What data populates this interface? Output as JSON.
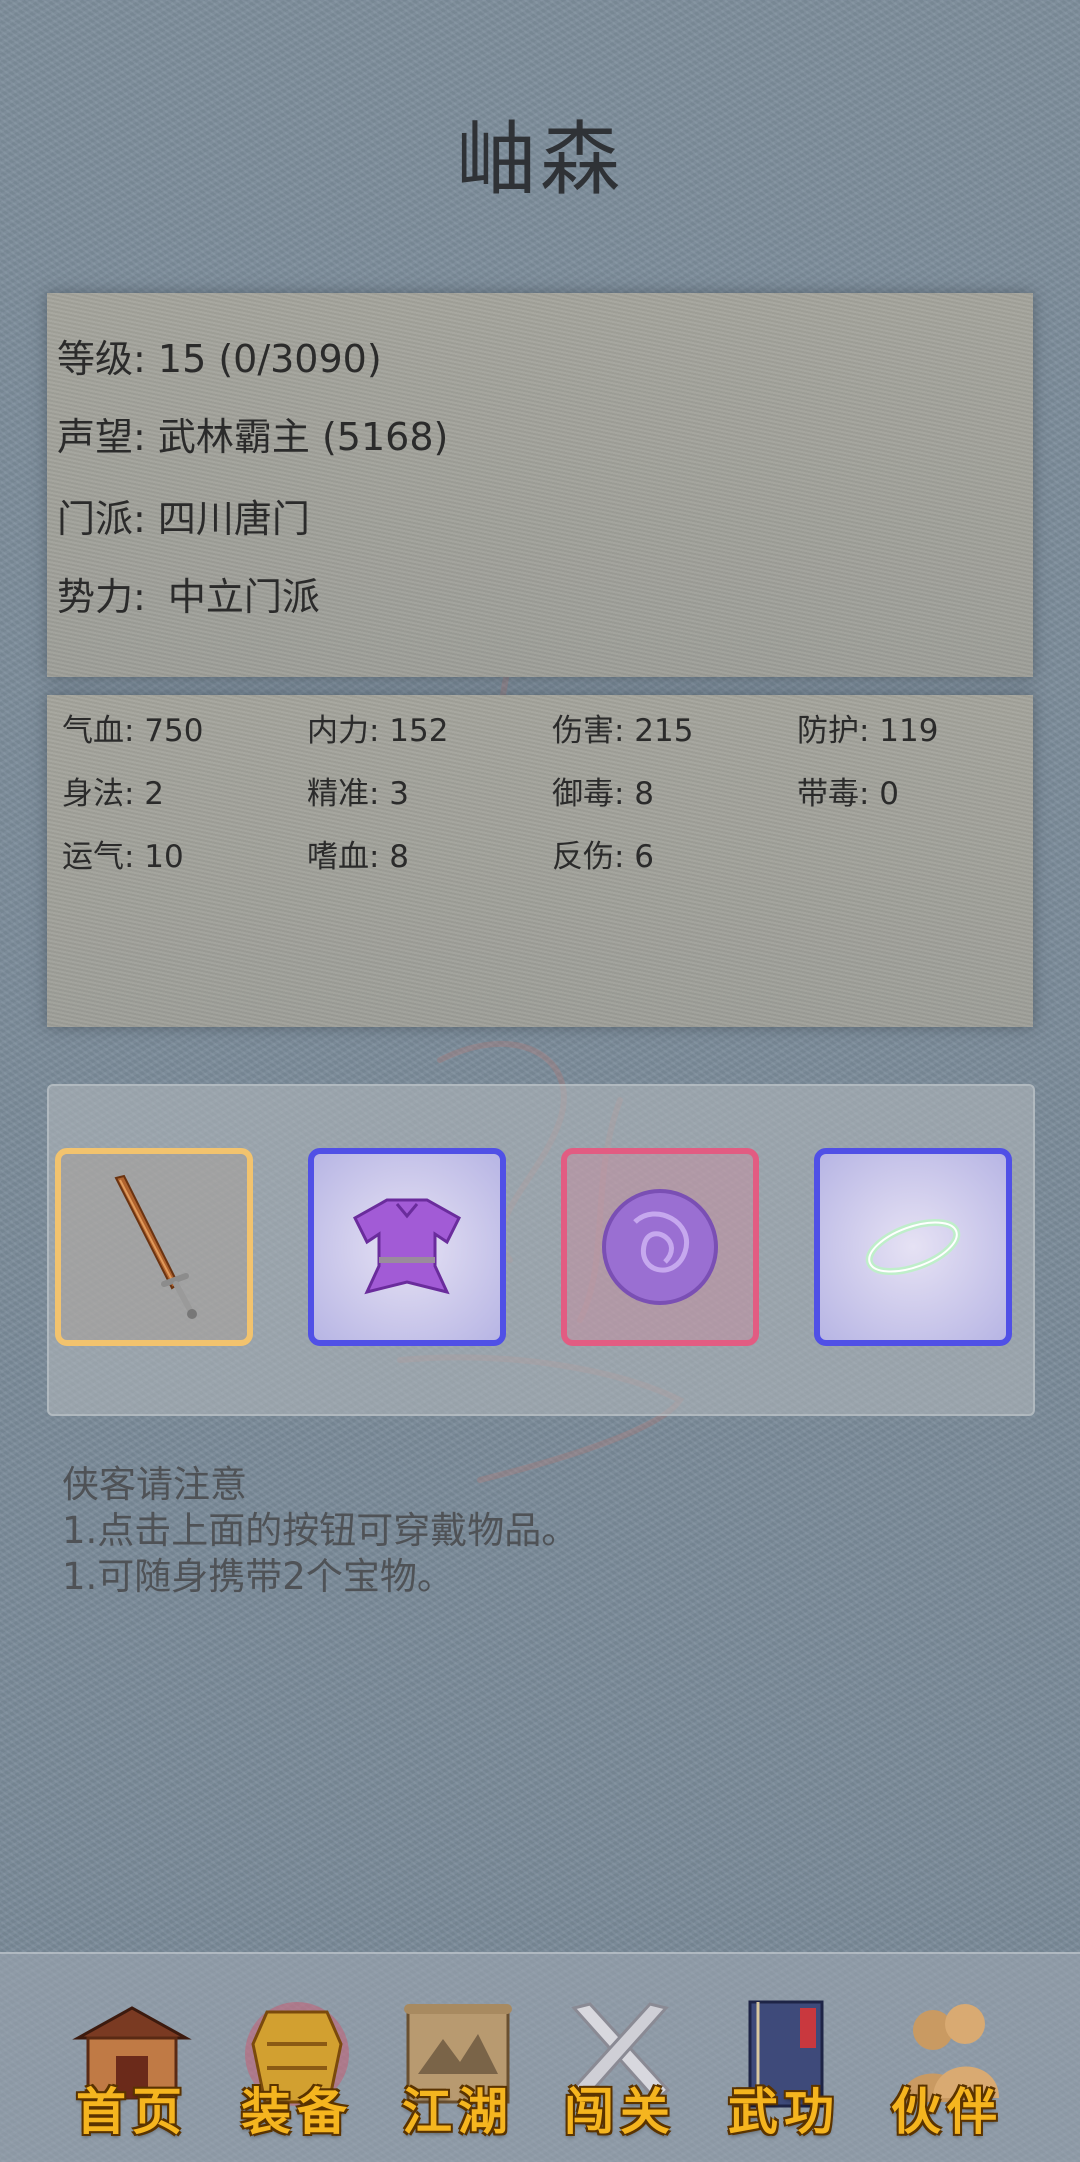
{
  "title": "岫森",
  "info": {
    "level_label": "等级: ",
    "level_value": "15 (0/3090)",
    "fame_label": "声望: ",
    "fame_value": "武林霸主 (5168)",
    "sect_label": "门派: ",
    "sect_value": "四川唐门",
    "faction_label": "势力: ",
    "faction_value": "中立门派"
  },
  "stats": [
    {
      "label": "气血: 750"
    },
    {
      "label": "内力: 152"
    },
    {
      "label": "伤害: 215"
    },
    {
      "label": "防护: 119"
    },
    {
      "label": "身法: 2"
    },
    {
      "label": "精准: 3"
    },
    {
      "label": "御毒: 8"
    },
    {
      "label": "带毒: 0"
    },
    {
      "label": "运气: 10"
    },
    {
      "label": "嗜血: 8"
    },
    {
      "label": "反伤: 6"
    }
  ],
  "equipment": [
    {
      "icon": "sword-icon",
      "rarity_color": "#f2c36e"
    },
    {
      "icon": "armor-icon",
      "rarity_color": "#5050e6"
    },
    {
      "icon": "orb-icon",
      "rarity_color": "#e25c82"
    },
    {
      "icon": "ring-icon",
      "rarity_color": "#5050e6"
    }
  ],
  "notice": {
    "title": "侠客请注意",
    "line1": "1.点击上面的按钮可穿戴物品。",
    "line2": "1.可随身携带2个宝物。"
  },
  "tabs": [
    {
      "label": "首页",
      "icon": "house-icon"
    },
    {
      "label": "装备",
      "icon": "armor-icon"
    },
    {
      "label": "江湖",
      "icon": "scroll-map-icon"
    },
    {
      "label": "闯关",
      "icon": "crossed-swords-icon"
    },
    {
      "label": "武功",
      "icon": "book-icon"
    },
    {
      "label": "伙伴",
      "icon": "companions-icon"
    }
  ],
  "colors": {
    "accent_gold": "#f5b51f",
    "rarity_orange": "#f2c36e",
    "rarity_blue": "#5050e6",
    "rarity_red": "#e25c82"
  }
}
